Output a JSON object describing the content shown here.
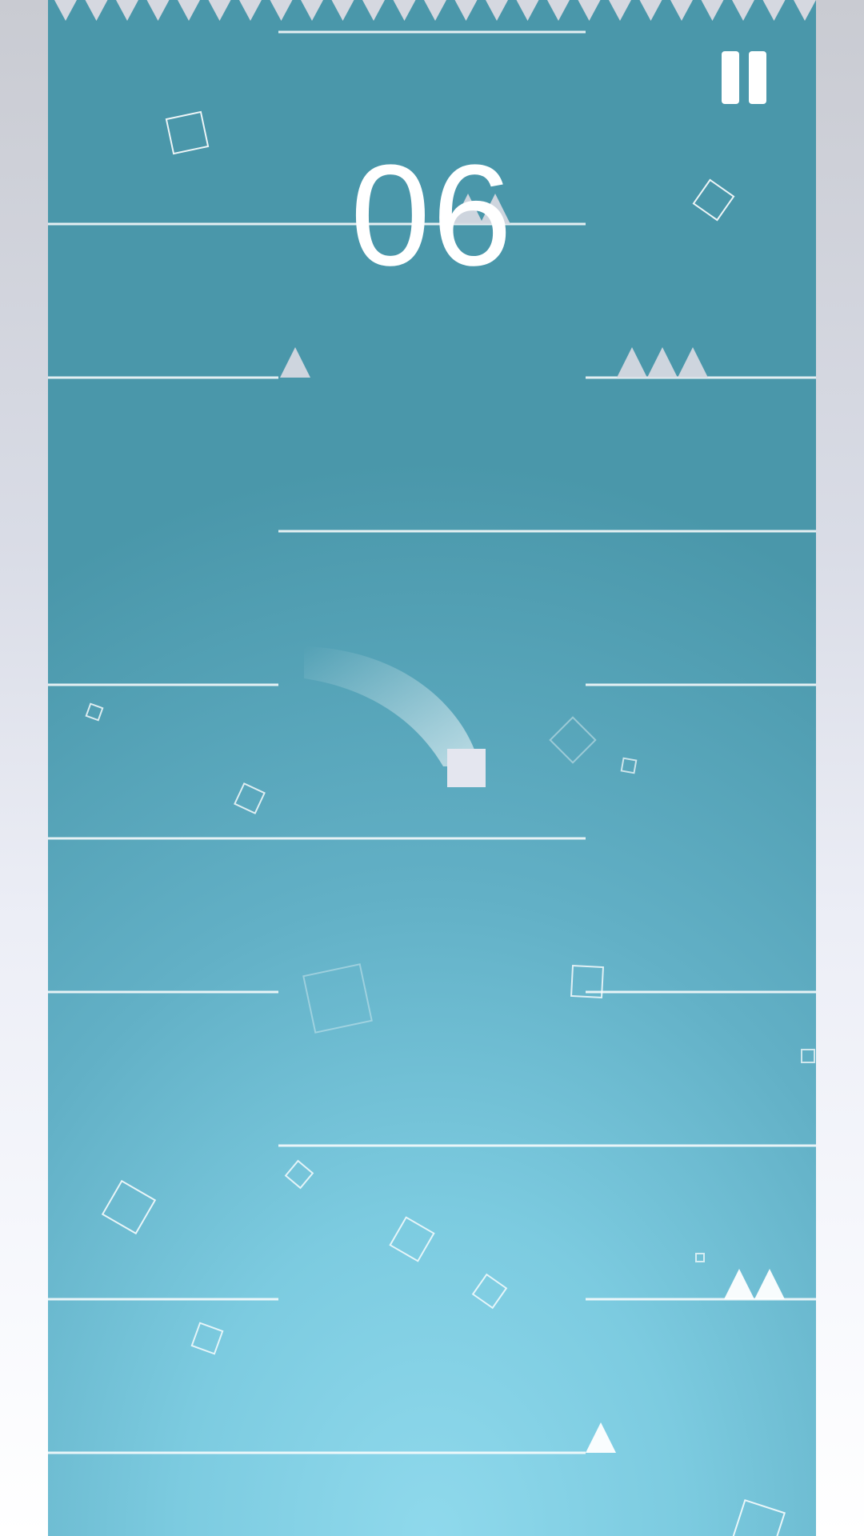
{
  "score": "06",
  "colors": {
    "stage_top": "#4a97aa",
    "stage_bottom": "#8fd9ec",
    "floor_line": "#ffffff",
    "spike": "#d5d8e0",
    "player": "#e4e6ef"
  },
  "icons": {
    "pause": "pause-icon",
    "player": "player-square",
    "spike": "triangle-spike-icon",
    "particle": "square-outline-icon"
  },
  "controls": {
    "pause_label": "Pause"
  }
}
